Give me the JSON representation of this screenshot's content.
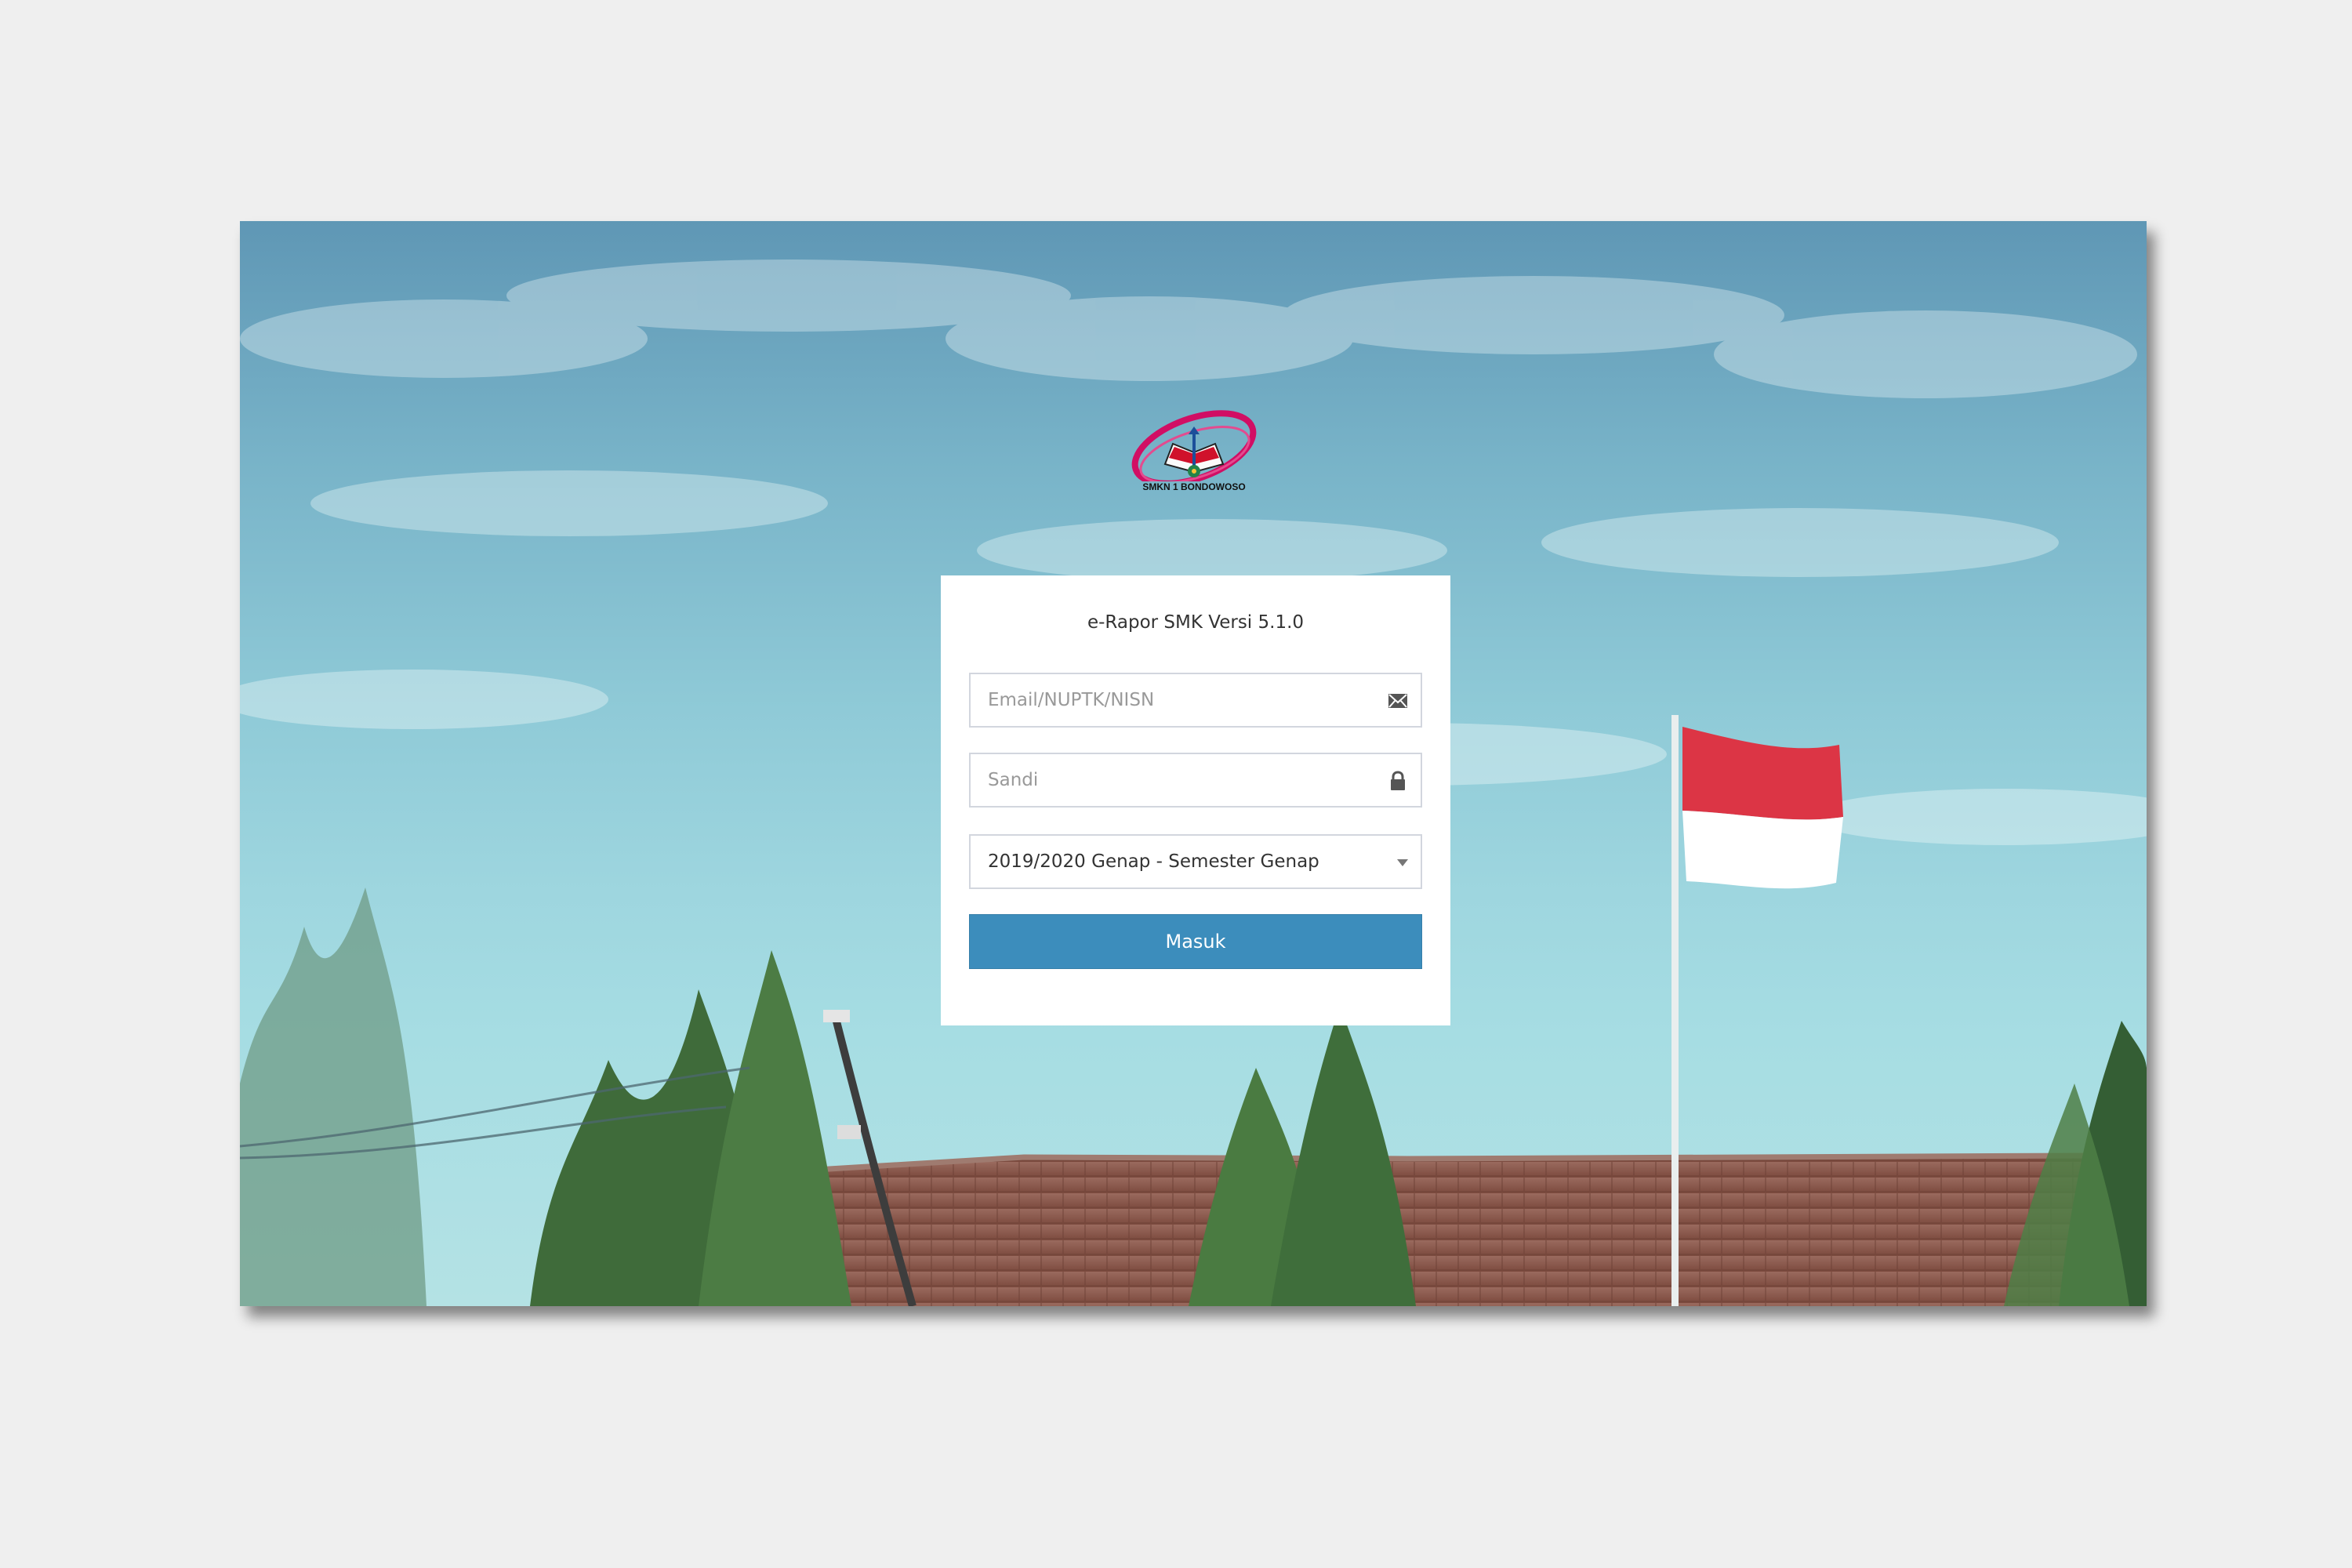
{
  "background": {
    "sky_color": "#8fcad7",
    "roof_color": "#8b5a4c",
    "tree_color": "#3f6b3a",
    "flag_colors": [
      "#dc3545",
      "#ffffff"
    ]
  },
  "branding": {
    "logo_icon": "school-logo-icon",
    "school_name": "SMKN 1 BONDOWOSO"
  },
  "login": {
    "title": "e-Rapor SMK Versi 5.1.0",
    "email": {
      "placeholder": "Email/NUPTK/NISN",
      "value": "",
      "icon": "envelope-icon"
    },
    "password": {
      "placeholder": "Sandi",
      "value": "",
      "icon": "lock-icon"
    },
    "semester": {
      "selected": "2019/2020 Genap - Semester Genap",
      "icon": "chevron-down-icon"
    },
    "submit_label": "Masuk",
    "accent_color": "#3c8dbc"
  }
}
